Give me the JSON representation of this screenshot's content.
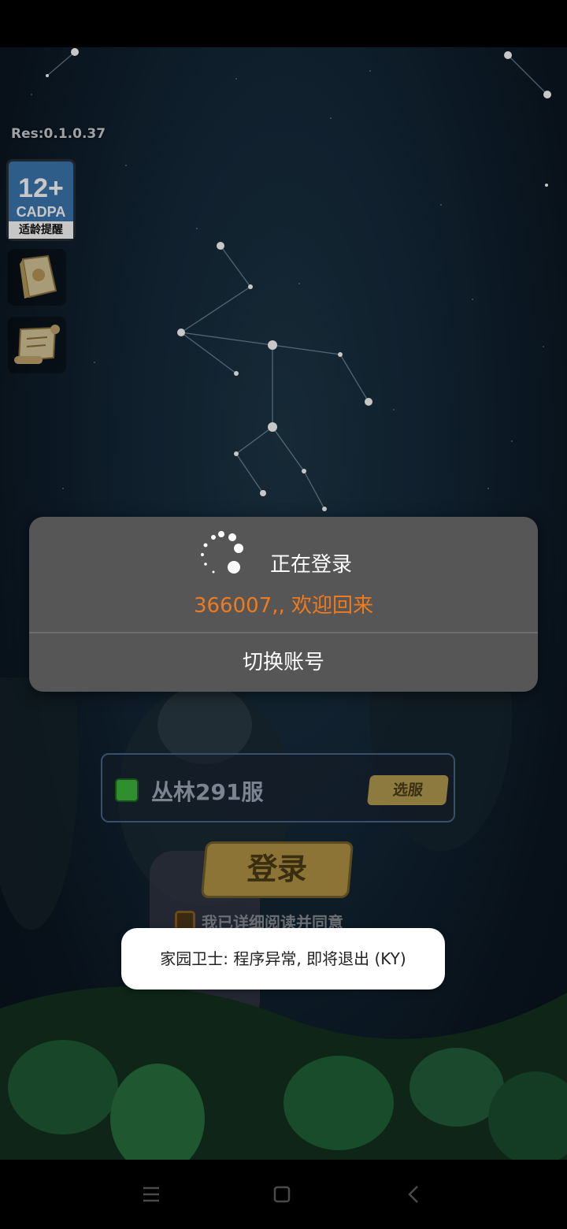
{
  "game": {
    "res_version": "Res:0.1.0.37",
    "age_badge": {
      "age": "12+",
      "org": "CADPA",
      "tip": "适龄提醒"
    },
    "side_icons": [
      "notice-book-icon",
      "scroll-icon"
    ],
    "server": {
      "name": "丛林291服",
      "select_label": "选服",
      "status_color": "#2f8f2f"
    },
    "login_label": "登录",
    "agree_text": "我已详细阅读并同意"
  },
  "dialog": {
    "title": "正在登录",
    "welcome": "366007,, 欢迎回来",
    "switch_account": "切换账号",
    "accent_color": "#f07a1e"
  },
  "toast": {
    "message": "家园卫士: 程序异常, 即将退出 (KY)"
  },
  "nav": {
    "buttons": [
      "menu-icon",
      "home-icon",
      "back-icon"
    ]
  }
}
